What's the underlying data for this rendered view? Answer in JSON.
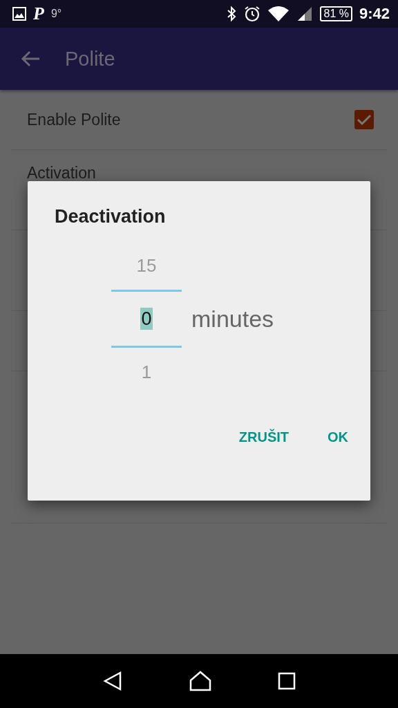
{
  "status_bar": {
    "app_notification": "P",
    "temperature": "9°",
    "battery": "81 %",
    "time": "9:42"
  },
  "app_bar": {
    "title": "Polite"
  },
  "settings": [
    {
      "title": "Enable Polite",
      "kind": "checkbox",
      "checked": true
    },
    {
      "title": "Activation",
      "kind": "text"
    }
  ],
  "dialog": {
    "title": "Deactivation",
    "picker": {
      "above": "15",
      "value": "0",
      "below": "1",
      "unit": "minutes"
    },
    "buttons": [
      "ZRUŠIT",
      "OK"
    ]
  }
}
